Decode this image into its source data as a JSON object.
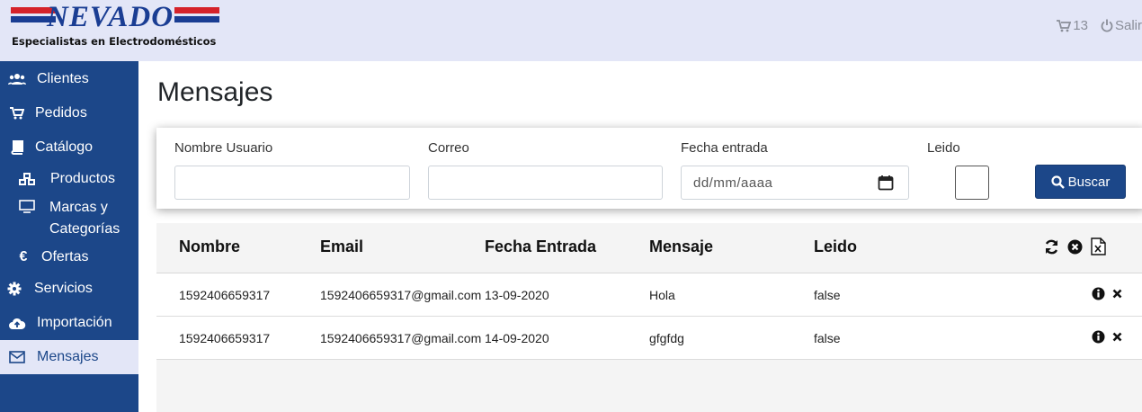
{
  "logo": {
    "brand": "NEVADO",
    "tagline": "Especialistas en Electrodomésticos"
  },
  "header": {
    "cart_count": "13",
    "logout_label": "Salir"
  },
  "sidebar": {
    "items": [
      {
        "label": "Clientes",
        "icon": "users-icon"
      },
      {
        "label": "Pedidos",
        "icon": "cart-icon"
      },
      {
        "label": "Catálogo",
        "icon": "book-icon"
      },
      {
        "label": "Productos",
        "icon": "cubes-icon"
      },
      {
        "label": "Marcas y",
        "label2": "Categorías",
        "icon": "monitor-icon"
      },
      {
        "label": "Ofertas",
        "icon": "euro-icon"
      },
      {
        "label": "Servicios",
        "icon": "gear-icon"
      },
      {
        "label": "Importación",
        "icon": "cloud-upload-icon"
      },
      {
        "label": "Mensajes",
        "icon": "envelope-icon",
        "active": true
      }
    ]
  },
  "page": {
    "title": "Mensajes"
  },
  "filters": {
    "nombre_label": "Nombre Usuario",
    "nombre_value": "",
    "correo_label": "Correo",
    "correo_value": "",
    "fecha_label": "Fecha entrada",
    "fecha_placeholder": "dd/mm/aaaa",
    "leido_label": "Leido",
    "buscar_label": "Buscar"
  },
  "table": {
    "headers": [
      "Nombre",
      "Email",
      "Fecha Entrada",
      "Mensaje",
      "Leido"
    ],
    "rows": [
      {
        "nombre": "1592406659317",
        "email": "1592406659317@gmail.com",
        "fecha": "13-09-2020",
        "mensaje": "Hola",
        "leido": "false"
      },
      {
        "nombre": "1592406659317",
        "email": "1592406659317@gmail.com",
        "fecha": "14-09-2020",
        "mensaje": "gfgfdg",
        "leido": "false"
      }
    ]
  },
  "colors": {
    "primary": "#1c4789",
    "header_bg": "#e3e6f7",
    "logo_red": "#d5222a"
  }
}
